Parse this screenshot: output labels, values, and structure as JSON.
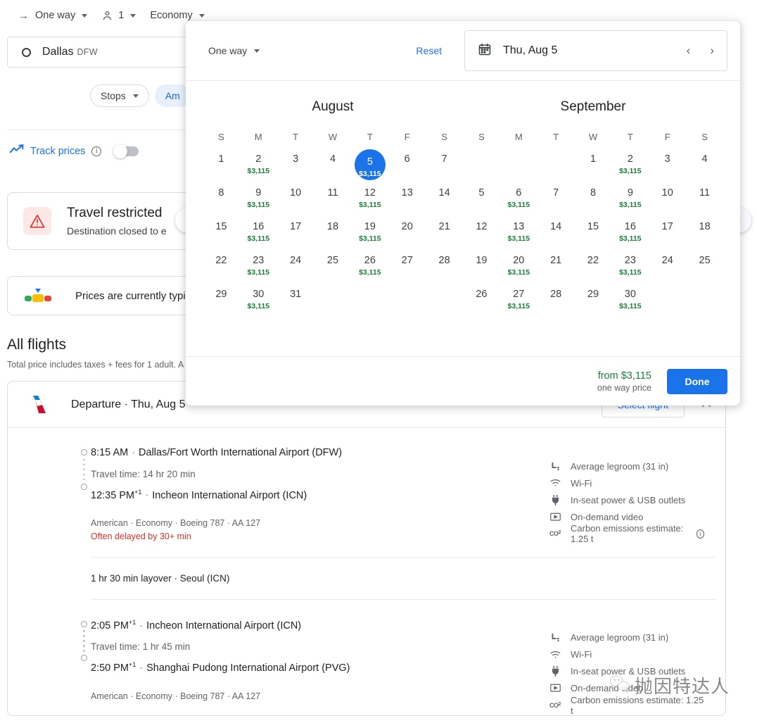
{
  "topbar": {
    "trip_type": "One way",
    "passengers": "1",
    "cabin": "Economy"
  },
  "search": {
    "origin_city": "Dallas",
    "origin_code": "DFW"
  },
  "filters": {
    "stops": "Stops",
    "amenities_partial": "Am"
  },
  "track_prices": {
    "label": "Track prices",
    "info": "i",
    "state": "off"
  },
  "notices": {
    "restricted_title": "Travel restricted",
    "restricted_sub": "Destination closed to e",
    "prices_text": "Prices are currently typic"
  },
  "all_flights": {
    "heading": "All flights",
    "subtext": "Total price includes taxes + fees for 1 adult. A"
  },
  "nav": {
    "prev": "‹",
    "next": "›"
  },
  "result": {
    "header": "Departure · Thu, Aug 5",
    "select_flight": "Select flight",
    "segments": [
      {
        "depart_time": "8:15 AM",
        "depart_sup": "",
        "depart_airport": "Dallas/Fort Worth International Airport (DFW)",
        "travel_time": "Travel time: 14 hr 20 min",
        "arrive_time": "12:35 PM",
        "arrive_sup": "+1",
        "arrive_airport": "Incheon International Airport (ICN)",
        "meta": "American · Economy · Boeing 787 · AA 127",
        "warning": "Often delayed by 30+ min",
        "amenities": [
          "Average legroom (31 in)",
          "Wi-Fi",
          "In-seat power & USB outlets",
          "On-demand video",
          "Carbon emissions estimate: 1.25 t"
        ]
      },
      {
        "depart_time": "2:05 PM",
        "depart_sup": "+1",
        "depart_airport": "Incheon International Airport (ICN)",
        "travel_time": "Travel time: 1 hr 45 min",
        "arrive_time": "2:50 PM",
        "arrive_sup": "+1",
        "arrive_airport": "Shanghai Pudong International Airport (PVG)",
        "meta": "American · Economy · Boeing 787 · AA 127",
        "warning": "",
        "amenities": [
          "Average legroom (31 in)",
          "Wi-Fi",
          "In-seat power & USB outlets",
          "On-demand video",
          "Carbon emissions estimate: 1.25 t"
        ]
      }
    ],
    "layover": "1 hr 30 min layover · Seoul (ICN)"
  },
  "dialog": {
    "trip_type": "One way",
    "reset": "Reset",
    "date_value": "Thu, Aug 5",
    "prev_month": "‹",
    "next_month": "›",
    "dow": [
      "S",
      "M",
      "T",
      "W",
      "T",
      "F",
      "S"
    ],
    "footer_price": "from $3,115",
    "footer_note": "one way price",
    "done": "Done",
    "months": [
      {
        "name": "August",
        "lead_blanks": 0,
        "days": [
          {
            "n": "1",
            "price": ""
          },
          {
            "n": "2",
            "price": "$3,115"
          },
          {
            "n": "3",
            "price": ""
          },
          {
            "n": "4",
            "price": ""
          },
          {
            "n": "5",
            "price": "$3,115",
            "selected": true
          },
          {
            "n": "6",
            "price": ""
          },
          {
            "n": "7",
            "price": ""
          },
          {
            "n": "8",
            "price": ""
          },
          {
            "n": "9",
            "price": "$3,115"
          },
          {
            "n": "10",
            "price": ""
          },
          {
            "n": "11",
            "price": ""
          },
          {
            "n": "12",
            "price": "$3,115"
          },
          {
            "n": "13",
            "price": ""
          },
          {
            "n": "14",
            "price": ""
          },
          {
            "n": "15",
            "price": ""
          },
          {
            "n": "16",
            "price": "$3,115"
          },
          {
            "n": "17",
            "price": ""
          },
          {
            "n": "18",
            "price": ""
          },
          {
            "n": "19",
            "price": "$3,115"
          },
          {
            "n": "20",
            "price": ""
          },
          {
            "n": "21",
            "price": ""
          },
          {
            "n": "22",
            "price": ""
          },
          {
            "n": "23",
            "price": "$3,115"
          },
          {
            "n": "24",
            "price": ""
          },
          {
            "n": "25",
            "price": ""
          },
          {
            "n": "26",
            "price": "$3,115"
          },
          {
            "n": "27",
            "price": ""
          },
          {
            "n": "28",
            "price": ""
          },
          {
            "n": "29",
            "price": ""
          },
          {
            "n": "30",
            "price": "$3,115"
          },
          {
            "n": "31",
            "price": ""
          }
        ]
      },
      {
        "name": "September",
        "lead_blanks": 3,
        "days": [
          {
            "n": "1",
            "price": ""
          },
          {
            "n": "2",
            "price": "$3,115"
          },
          {
            "n": "3",
            "price": ""
          },
          {
            "n": "4",
            "price": ""
          },
          {
            "n": "5",
            "price": ""
          },
          {
            "n": "6",
            "price": "$3,115"
          },
          {
            "n": "7",
            "price": ""
          },
          {
            "n": "8",
            "price": ""
          },
          {
            "n": "9",
            "price": "$3,115"
          },
          {
            "n": "10",
            "price": ""
          },
          {
            "n": "11",
            "price": ""
          },
          {
            "n": "12",
            "price": ""
          },
          {
            "n": "13",
            "price": "$3,115"
          },
          {
            "n": "14",
            "price": ""
          },
          {
            "n": "15",
            "price": ""
          },
          {
            "n": "16",
            "price": "$3,115"
          },
          {
            "n": "17",
            "price": ""
          },
          {
            "n": "18",
            "price": ""
          },
          {
            "n": "19",
            "price": ""
          },
          {
            "n": "20",
            "price": "$3,115"
          },
          {
            "n": "21",
            "price": ""
          },
          {
            "n": "22",
            "price": ""
          },
          {
            "n": "23",
            "price": "$3,115"
          },
          {
            "n": "24",
            "price": ""
          },
          {
            "n": "25",
            "price": ""
          },
          {
            "n": "26",
            "price": ""
          },
          {
            "n": "27",
            "price": "$3,115"
          },
          {
            "n": "28",
            "price": ""
          },
          {
            "n": "29",
            "price": ""
          },
          {
            "n": "30",
            "price": "$3,115"
          }
        ]
      }
    ]
  },
  "watermark": {
    "text": "抛因特达人"
  },
  "colors": {
    "accent_blue": "#1a73e8",
    "price_green": "#188038",
    "warn_red": "#d93025"
  }
}
